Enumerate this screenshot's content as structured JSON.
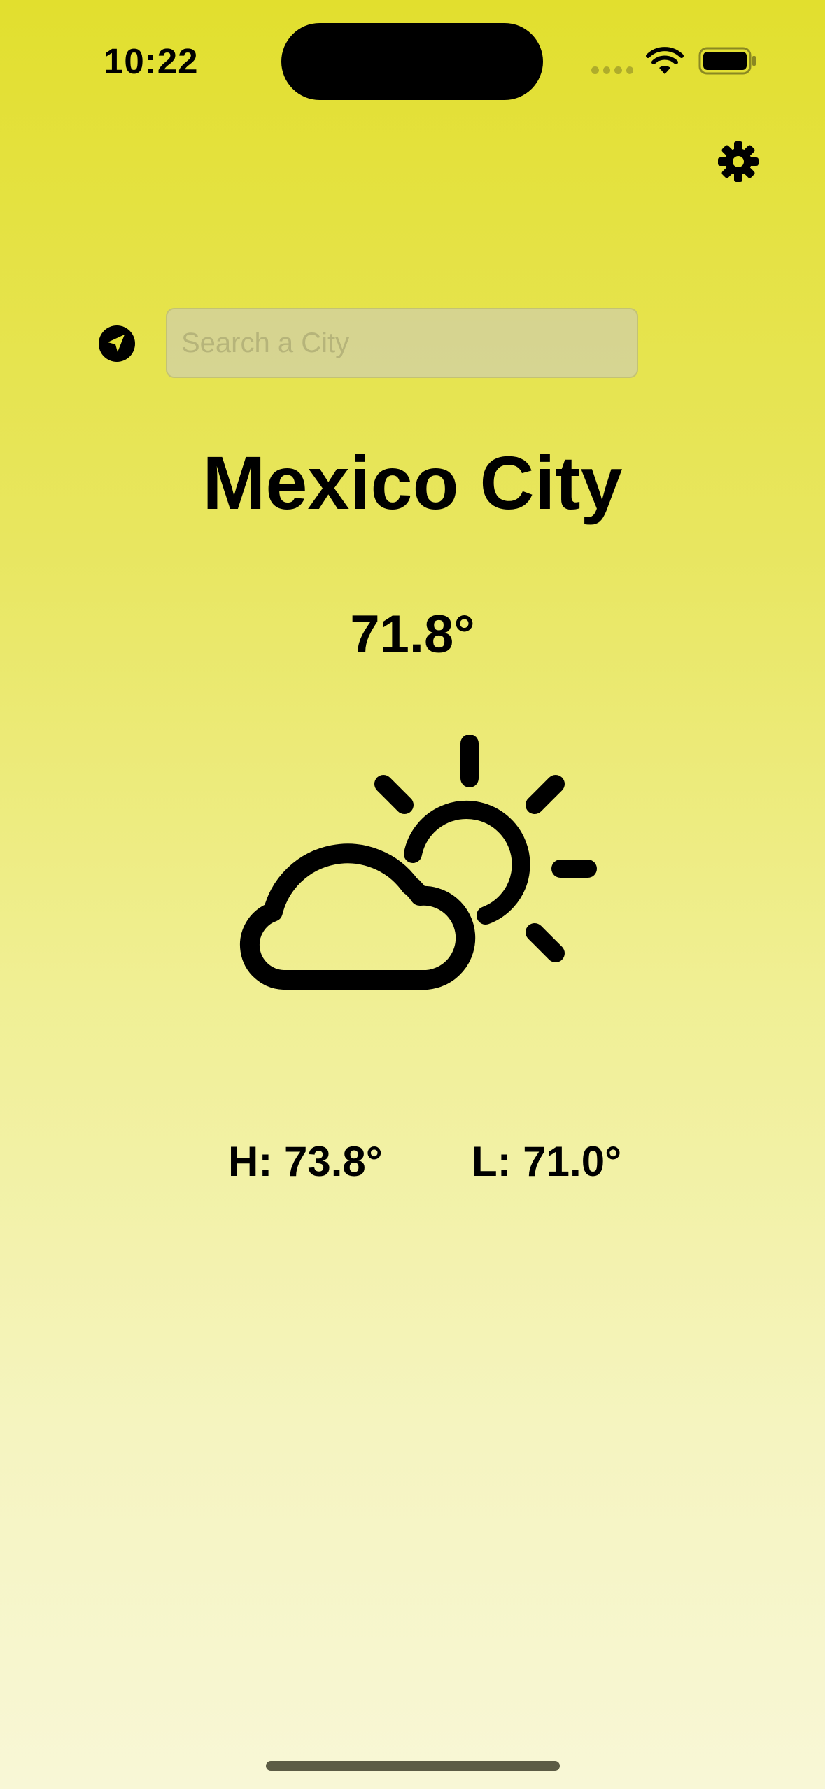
{
  "status_bar": {
    "time": "10:22"
  },
  "search": {
    "placeholder": "Search a City",
    "value": ""
  },
  "weather": {
    "city": "Mexico City",
    "temperature": "71.8°",
    "condition_icon": "cloud-sun-icon",
    "high": "H: 73.8°",
    "low": "L: 71.0°"
  },
  "icons": {
    "settings": "gear-icon",
    "location": "location-arrow-icon",
    "wifi": "wifi-icon",
    "battery": "battery-icon"
  },
  "colors": {
    "background_top": "#e2df2e",
    "background_bottom": "#f8f7d6",
    "search_background": "#d9d8a6",
    "foreground": "#000000"
  }
}
